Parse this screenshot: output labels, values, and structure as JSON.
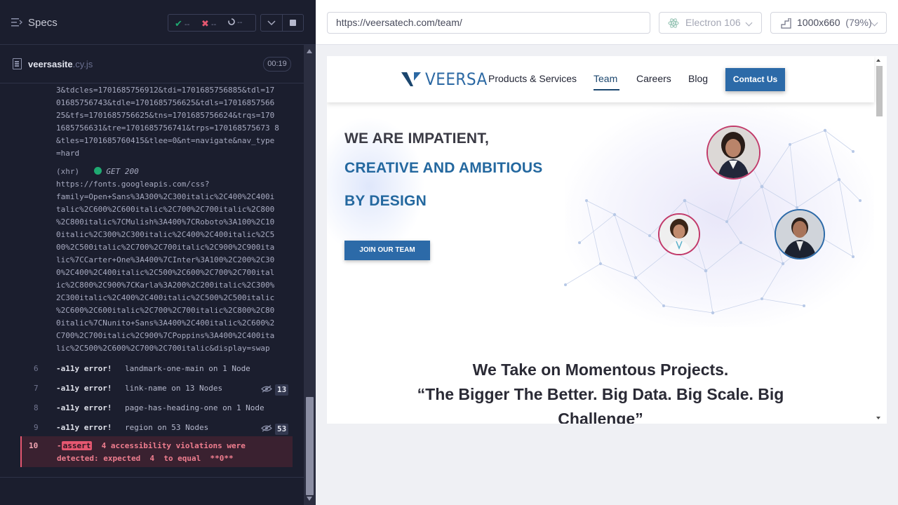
{
  "specs": {
    "title": "Specs",
    "passed": "--",
    "failed": "--",
    "pending": "--",
    "check_glyph": "✔",
    "x_glyph": "✖"
  },
  "spec_file": {
    "name": "veersasite",
    "ext": ".cy.js",
    "timer": "00:19"
  },
  "log": {
    "url_tail": "3&tdcles=1701685756912&tdi=1701685756885&tdl=17\n01685756743&tdle=1701685756625&tdls=17016857566\n25&tfs=1701685756625&tns=1701685756624&trqs=170\n1685756631&tre=1701685756741&trps=170168575673 8\n&tles=1701685760415&tlee=0&nt=navigate&nav_type\n=hard",
    "xhr_label": "(xhr)",
    "xhr_method": "GET 200",
    "xhr_url": "https://fonts.googleapis.com/css?\nfamily=Open+Sans%3A300%2C300italic%2C400%2C400i\ntalic%2C600%2C600italic%2C700%2C700italic%2C800\n%2C800italic%7CMulish%3A400%7CRoboto%3A100%2C10\n0italic%2C300%2C300italic%2C400%2C400italic%2C5\n00%2C500italic%2C700%2C700italic%2C900%2C900ita\nlic%7CCarter+One%3A400%7CInter%3A100%2C200%2C30\n0%2C400%2C400italic%2C500%2C600%2C700%2C700ital\nic%2C800%2C900%7CKarla%3A200%2C200italic%2C300%\n2C300italic%2C400%2C400italic%2C500%2C500italic\n%2C600%2C600italic%2C700%2C700italic%2C800%2C80\n0italic%7CNunito+Sans%3A400%2C400italic%2C600%2\nC700%2C700italic%2C900%7CPoppins%3A400%2C400ita\nlic%2C500%2C600%2C700%2C700italic&display=swap",
    "commands": [
      {
        "num": "6",
        "name": "-a11y error!",
        "msg": "landmark-one-main on 1 Node",
        "badge": ""
      },
      {
        "num": "7",
        "name": "-a11y error!",
        "msg": "link-name on 13 Nodes",
        "badge": "13"
      },
      {
        "num": "8",
        "name": "-a11y error!",
        "msg": "page-has-heading-one on 1 Node",
        "badge": ""
      },
      {
        "num": "9",
        "name": "-a11y error!",
        "msg": "region on 53 Nodes",
        "badge": "53"
      }
    ],
    "assert": {
      "num": "10",
      "prefix": "-",
      "tag": "assert",
      "line1_rest": "  4 accessibility violations were",
      "line2": "detected: expected  4  to equal  **0**"
    }
  },
  "browser": {
    "url": "https://veersatech.com/team/",
    "engine": "Electron 106",
    "viewport": "1000x660",
    "zoom": "(79%)"
  },
  "site": {
    "logo": "VEERSA",
    "nav": [
      "Products & Services",
      "Team",
      "Careers",
      "Blog"
    ],
    "contact": "Contact Us",
    "hero_line1": "WE ARE IMPATIENT,",
    "hero_line2": "CREATIVE AND AMBITIOUS",
    "hero_line3": "BY DESIGN",
    "join": "JOIN OUR TEAM",
    "tagline1": "We Take on Momentous Projects.",
    "tagline2": "“The Bigger The Better. Big Data. Big Scale. Big",
    "tagline3": "Challenge”"
  },
  "colors": {
    "brand_blue": "#2c6aa8",
    "hero_dark": "#3a3a44",
    "hero_blue": "#24689f",
    "assert_red": "#e45770"
  }
}
